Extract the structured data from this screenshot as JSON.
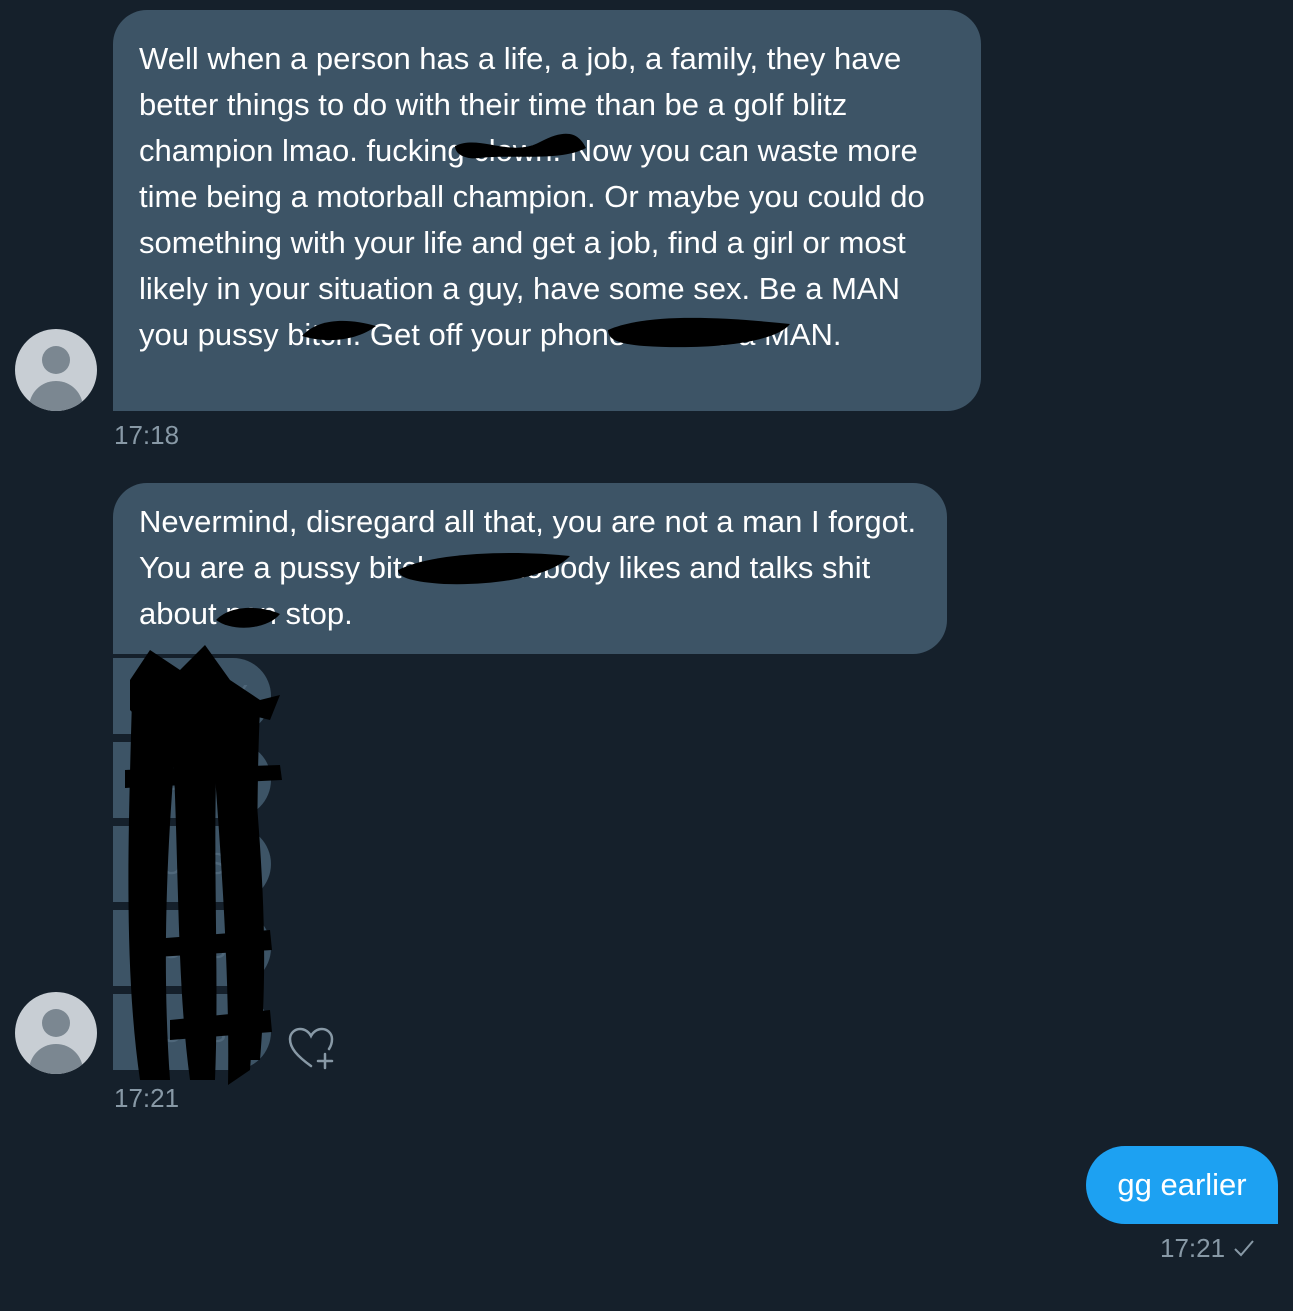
{
  "messages": [
    {
      "direction": "incoming",
      "text": "Well when a person has a life, a job, a family, they have better things to do with their time than be a golf blitz champion lmao. fucking clown. Now you can waste more time being a motorball champion. Or maybe you could do something with your life and get a job, find a girl or most likely in your situation a guy, have some sex. Be a MAN you pussy bitch. Get off your phone and be a MAN.",
      "time": "17:18"
    },
    {
      "direction": "incoming",
      "text": "Nevermind, disregard all that, you are not a man I forgot. You are a pussy bitch who nobody likes and talks shit about non stop.",
      "small_messages": [
        "PUSSY",
        "PUSSY",
        "PUSSY",
        "PUSSY",
        "PUSSY"
      ],
      "time": "17:21"
    },
    {
      "direction": "outgoing",
      "text": "gg earlier",
      "time": "17:21",
      "status_icon": "single-check-icon"
    }
  ],
  "icons": {
    "avatar": "default-avatar-icon",
    "reaction": "heart-plus-icon"
  },
  "colors": {
    "background": "#15202b",
    "incoming_bubble": "#3d5466",
    "outgoing_bubble": "#1da1f2",
    "timestamp": "#8899a6"
  }
}
